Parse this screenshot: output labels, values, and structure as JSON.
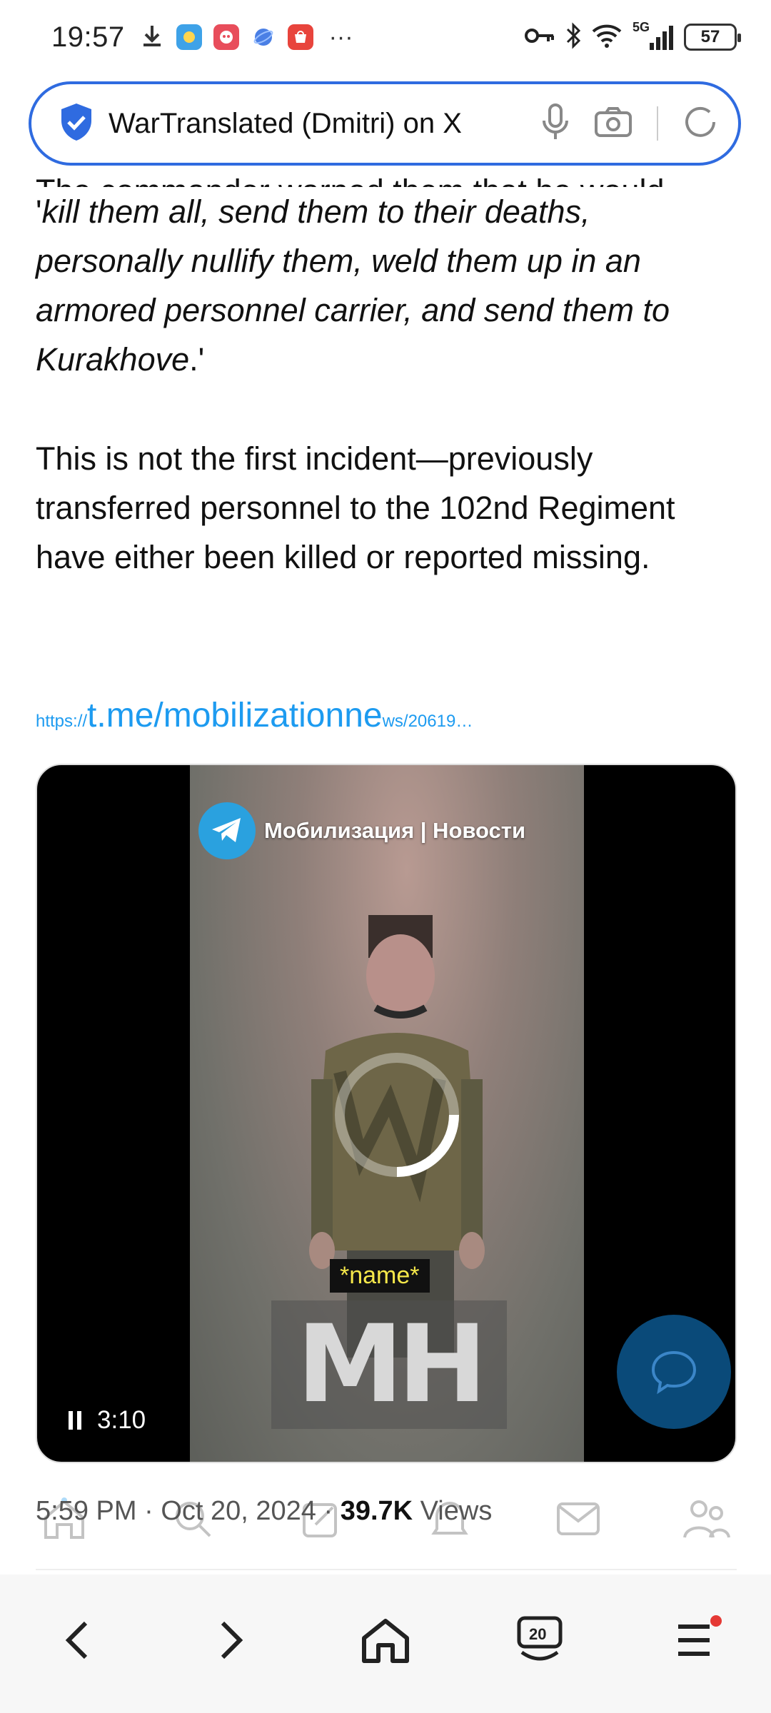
{
  "status_bar": {
    "time": "19:57",
    "more": "···",
    "network": "5G",
    "battery": "57",
    "icons": [
      "download-icon",
      "weather-icon",
      "game-app-icon",
      "browser-app-icon",
      "huawei-app-icon",
      "key-icon",
      "bluetooth-icon",
      "wifi-icon",
      "signal-icon"
    ]
  },
  "search_bar": {
    "text": "WarTranslated (Dmitri) on X",
    "icons": [
      "shield-check-icon",
      "microphone-icon",
      "camera-icon",
      "refresh-icon"
    ]
  },
  "article": {
    "cut_line": "The commander warned them that he would",
    "quote_open": "'",
    "quote": "kill them all, send them to their deaths, personally nullify them, weld them up in an armored personnel carrier, and send them to Kurakhove",
    "quote_close": ".'",
    "paragraph2": "This is not the first incident—previously transferred personnel to the 102nd Regiment have either been killed or reported missing.",
    "link_prefix": "https://",
    "link_main": "t.me/mobilizationne",
    "link_suffix": "ws/20619…"
  },
  "video": {
    "channel": "Мобилизация | Новости",
    "name_caption": "*name*",
    "watermark": "MH",
    "time": "3:10",
    "state": "playing"
  },
  "post_meta": {
    "time": "5:59 PM",
    "sep1": " · ",
    "date": "Oct 20, 2024",
    "sep2": " · ",
    "views": "39.7K",
    "views_label": " Views"
  },
  "x_tabbar": [
    "home-icon",
    "search-icon",
    "compose-icon",
    "notifications-icon",
    "messages-icon",
    "communities-icon"
  ],
  "browser_bar": {
    "tabs_count": "20",
    "buttons": [
      "back",
      "forward",
      "home",
      "tabs",
      "menu"
    ]
  },
  "colors": {
    "accent": "#2f6be0",
    "link": "#1d9bf0",
    "fab": "#0a4a79",
    "caption_text": "#f6e84a",
    "badge": "#e53935"
  }
}
